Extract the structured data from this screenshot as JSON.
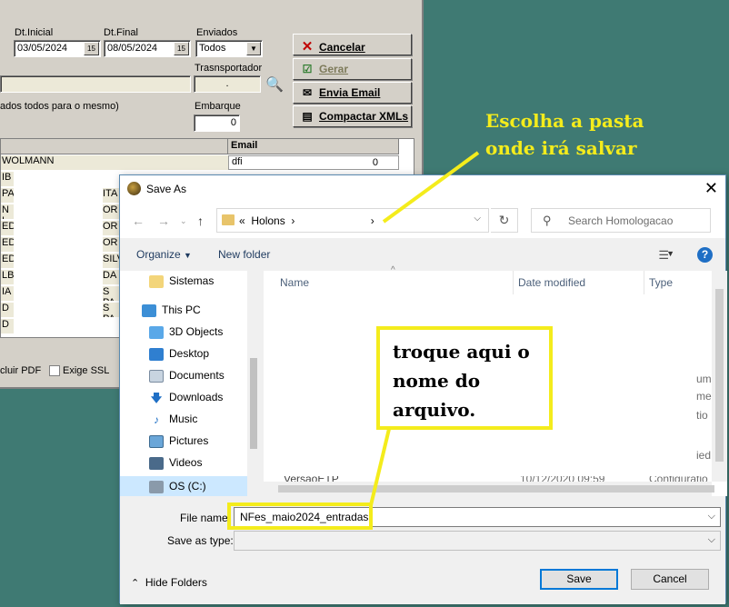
{
  "app": {
    "dt_inicial_label": "Dt.Inicial",
    "dt_inicial_value": "03/05/2024",
    "dt_final_label": "Dt.Final",
    "dt_final_value": "08/05/2024",
    "calendar_btn": "15",
    "enviados_label": "Enviados",
    "enviados_value": "Todos",
    "transportador_label": "Trasnsportador",
    "transportador_value": ".",
    "partial_label": "ados todos para o mesmo)",
    "embarque_label": "Embarque",
    "embarque_value": "0",
    "buttons": {
      "cancelar": "Cancelar",
      "gerar": "Gerar",
      "envia_email": "Envia Email",
      "compactar": "Compactar XMLs"
    },
    "grid_email_header": "Email",
    "grid_first_row_text": "WOLMANN",
    "grid_first_email": "dfi",
    "grid_first_zero": "0",
    "grid_left_cells": [
      "IB",
      "PA",
      "N I",
      "ED",
      "ED",
      "ED",
      "LB",
      "IA",
      "D",
      "D"
    ],
    "grid_right_cells": [
      "ITA",
      "OR",
      "OR",
      "OR",
      "SILV",
      "DA",
      "S PA",
      "S PA"
    ],
    "excluir_pdf": "cluir PDF",
    "exige_ssl": "Exige SSL"
  },
  "dialog": {
    "title": "Save As",
    "address": {
      "crumb_prefix": "«",
      "crumb_holons": "Holons",
      "crumb_sep": "›",
      "crumb_partial": "›"
    },
    "search_placeholder": "Search Homologacao",
    "toolbar": {
      "organize": "Organize",
      "new_folder": "New folder",
      "help": "?"
    },
    "nav": {
      "sistemas": "Sistemas",
      "this_pc": "This PC",
      "objects3d": "3D Objects",
      "desktop": "Desktop",
      "documents": "Documents",
      "downloads": "Downloads",
      "music": "Music",
      "pictures": "Pictures",
      "videos": "Videos",
      "os_c": "OS (C:)"
    },
    "columns": {
      "name": "Name",
      "date_modified": "Date modified",
      "type": "Type"
    },
    "partial_type_fragments": [
      "ume",
      "me",
      "tio",
      "ied"
    ],
    "partial_row": {
      "name": "VersaoETP",
      "date": "10/12/2020 09:59",
      "type": "Configuratio"
    },
    "file_name_label": "File name:",
    "file_name_value": "NFes_maio2024_entradas",
    "save_as_type_label": "Save as type:",
    "save_as_type_value": "",
    "hide_folders": "Hide Folders",
    "save_button": "Save",
    "cancel_button": "Cancel"
  },
  "annotations": {
    "top_note": "Escolha a pasta\nonde irá salvar",
    "box_note": "troque aqui o\nnome do\narquivo.",
    "color": "#f4ec1c"
  }
}
